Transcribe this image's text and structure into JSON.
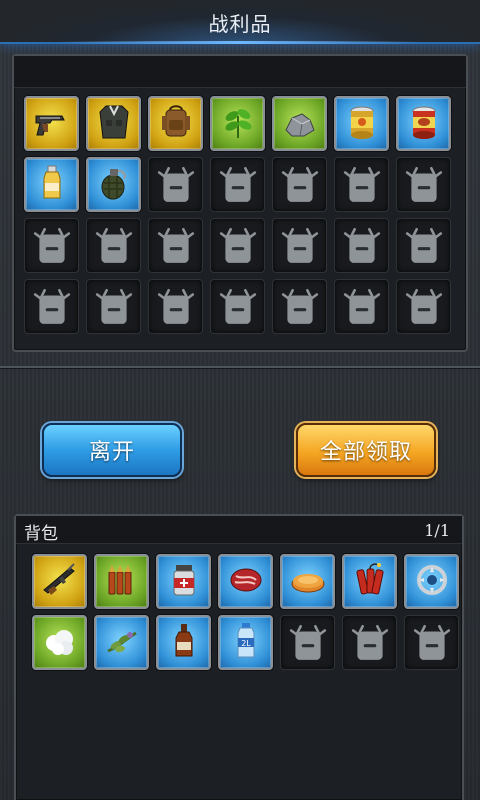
{
  "title": "战利品",
  "buttons": {
    "leave": "离开",
    "claim_all": "全部领取"
  },
  "loot": {
    "items": [
      {
        "name": "pistol-icon",
        "rarity": "yellow"
      },
      {
        "name": "vest-icon",
        "rarity": "yellow"
      },
      {
        "name": "backpack-icon",
        "rarity": "yellow"
      },
      {
        "name": "herb-icon",
        "rarity": "green"
      },
      {
        "name": "ore-icon",
        "rarity": "green"
      },
      {
        "name": "canned-food-icon",
        "rarity": "blue"
      },
      {
        "name": "canned-meat-icon",
        "rarity": "blue"
      },
      {
        "name": "juice-bottle-icon",
        "rarity": "blue"
      },
      {
        "name": "grenade-icon",
        "rarity": "blue"
      }
    ],
    "total_slots": 28
  },
  "bag": {
    "title": "背包",
    "page": "1/1",
    "items": [
      {
        "name": "rifle-icon",
        "rarity": "yellow"
      },
      {
        "name": "bullets-icon",
        "rarity": "green"
      },
      {
        "name": "medicine-jar-icon",
        "rarity": "blue"
      },
      {
        "name": "steak-icon",
        "rarity": "blue"
      },
      {
        "name": "pie-icon",
        "rarity": "blue"
      },
      {
        "name": "dynamite-icon",
        "rarity": "blue"
      },
      {
        "name": "bear-trap-icon",
        "rarity": "blue"
      },
      {
        "name": "cotton-icon",
        "rarity": "green"
      },
      {
        "name": "herbs-bundle-icon",
        "rarity": "blue"
      },
      {
        "name": "bottle-icon",
        "rarity": "blue"
      },
      {
        "name": "water-bottle-icon",
        "rarity": "blue"
      }
    ],
    "total_slots": 14
  },
  "water_bottle_label": "2L"
}
